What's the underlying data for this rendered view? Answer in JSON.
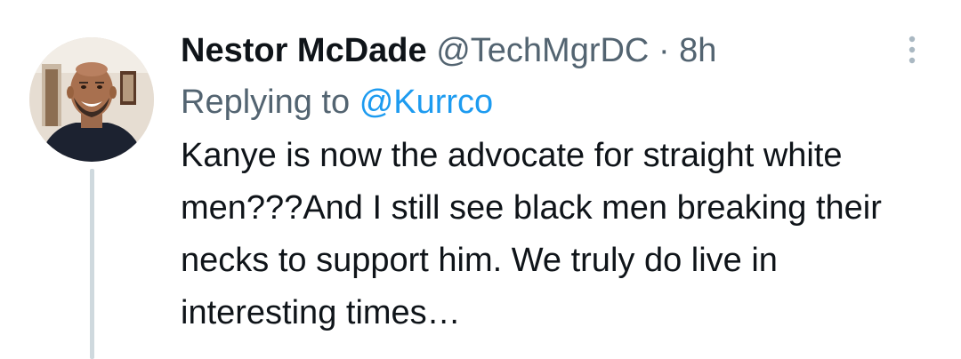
{
  "tweet": {
    "display_name": "Nestor McDade",
    "handle": "@TechMgrDC",
    "separator": "·",
    "time": "8h",
    "replying_prefix": "Replying to",
    "replying_to": "@Kurrco",
    "text": "Kanye is now the advocate for straight white men???And I still see black men breaking their necks to support him. We truly do live in interesting times…"
  },
  "icons": {
    "more": "more-vertical-icon",
    "avatar": "profile-photo"
  },
  "colors": {
    "text": "#0f1419",
    "secondary": "#536471",
    "link": "#1d9bf0",
    "thread_line": "#cfd9de"
  }
}
